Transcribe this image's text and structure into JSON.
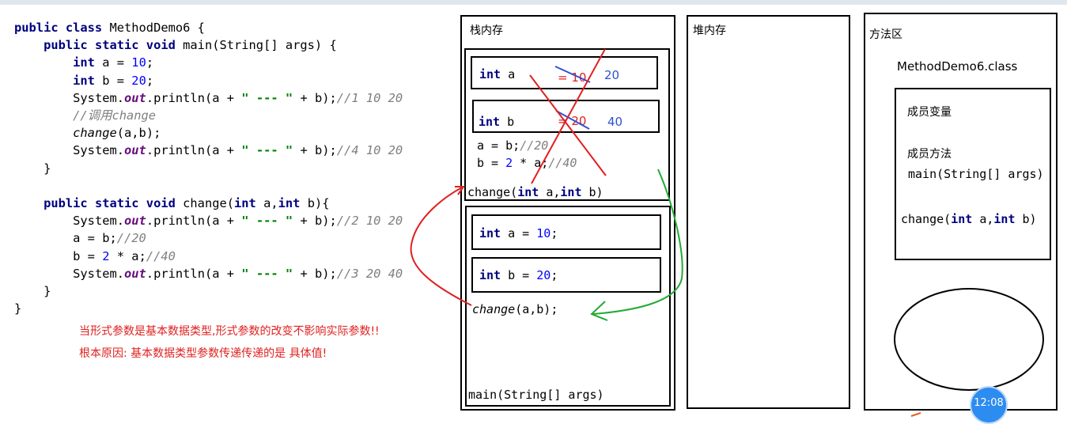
{
  "code": {
    "l1": {
      "kw": "public class",
      "rest": " MethodDemo6 {"
    },
    "l2": {
      "kw": "public static void",
      "rest": " main(String[] args) {"
    },
    "l3": {
      "kw": "int",
      "pre": " a = ",
      "num": "10",
      "post": ";"
    },
    "l4": {
      "kw": "int",
      "pre": " b = ",
      "num": "20",
      "post": ";"
    },
    "l5": {
      "a": "System.",
      "fld": "out",
      "b": ".println(a + ",
      "str": "\" --- \"",
      "c": " + b);",
      "cm": "//1 10 20"
    },
    "l6": {
      "cm": "//调用change"
    },
    "l7": {
      "call": "change",
      "rest": "(a,b);"
    },
    "l8": {
      "a": "System.",
      "fld": "out",
      "b": ".println(a + ",
      "str": "\" --- \"",
      "c": " + b);",
      "cm": "//4 10 20"
    },
    "l9": "}",
    "l10": {
      "kw": "public static void",
      "mid": " change(",
      "kw2": "int",
      "mid2": " a,",
      "kw3": "int",
      "end": " b){"
    },
    "l11": {
      "a": "System.",
      "fld": "out",
      "b": ".println(a + ",
      "str": "\" --- \"",
      "c": " + b);",
      "cm": "//2 10 20"
    },
    "l12": {
      "a": "a = b;",
      "cm": "//20"
    },
    "l13": {
      "a": "b = ",
      "num": "2",
      "b": " * a;",
      "cm": "//40"
    },
    "l14": {
      "a": "System.",
      "fld": "out",
      "b": ".println(a + ",
      "str": "\" --- \"",
      "c": " + b);",
      "cm": "//3 20 40"
    },
    "l15": "}",
    "l16": "}"
  },
  "notes": {
    "n1": "当形式参数是基本数据类型,形式参数的改变不影响实际参数!!",
    "n2": "根本原因: 基本数据类型参数传递传递的是 具体值!"
  },
  "stack": {
    "title": "栈内存",
    "change_frame": {
      "a_kw": "int",
      "a_var": " a",
      "a_old": "= 10",
      "a_new": "20",
      "b_kw": "int",
      "b_var": " b",
      "b_old": "= 20",
      "b_new": "40",
      "line1_a": "a = b;",
      "line1_cm": "//20",
      "line2_a": "b = ",
      "line2_num": "2",
      "line2_b": " * a;",
      "line2_cm": "//40",
      "label_a": "change(",
      "label_kw1": "int",
      "label_b": " a,",
      "label_kw2": "int",
      "label_c": " b)"
    },
    "main_frame": {
      "a_kw": "int",
      "a_pre": " a = ",
      "a_num": "10",
      "a_post": ";",
      "b_kw": "int",
      "b_pre": " b = ",
      "b_num": "20",
      "b_post": ";",
      "call_name": "change",
      "call_rest": "(a,b);",
      "label": "main(String[] args)"
    }
  },
  "heap": {
    "title": "堆内存"
  },
  "method_area": {
    "title": "方法区",
    "class_name": "MethodDemo6.class",
    "member_vars": "成员变量",
    "member_methods": "成员方法",
    "main_sig": "main(String[] args)",
    "change_a": "change(",
    "change_kw1": "int",
    "change_b": " a,",
    "change_kw2": "int",
    "change_c": " b)"
  },
  "badge": {
    "time": "12:08"
  },
  "colors": {
    "keyword": "#000080",
    "number": "#0000ff",
    "string": "#008000",
    "comment": "#808080",
    "note": "#e02020",
    "arrow_red": "#e02020",
    "arrow_green": "#22aa33",
    "ink_blue": "#3050d0"
  }
}
